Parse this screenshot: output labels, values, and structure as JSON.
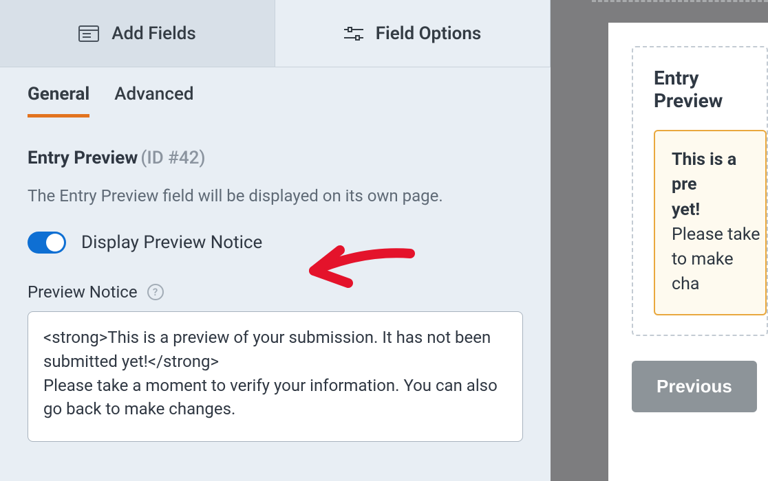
{
  "topTabs": {
    "addFields": "Add Fields",
    "fieldOptions": "Field Options"
  },
  "subTabs": {
    "general": "General",
    "advanced": "Advanced"
  },
  "section": {
    "title": "Entry Preview",
    "id": "(ID #42)",
    "description": "The Entry Preview field will be displayed on its own page."
  },
  "toggle": {
    "label": "Display Preview Notice"
  },
  "previewNotice": {
    "label": "Preview Notice",
    "value": "<strong>This is a preview of your submission. It has not been submitted yet!</strong>\nPlease take a moment to verify your information. You can also go back to make changes."
  },
  "preview": {
    "title": "Entry Preview",
    "noticeBold1": "This is a pre",
    "noticeBold2": "yet!",
    "noticeLine1": "Please take",
    "noticeLine2": "to make cha",
    "previousButton": "Previous"
  }
}
